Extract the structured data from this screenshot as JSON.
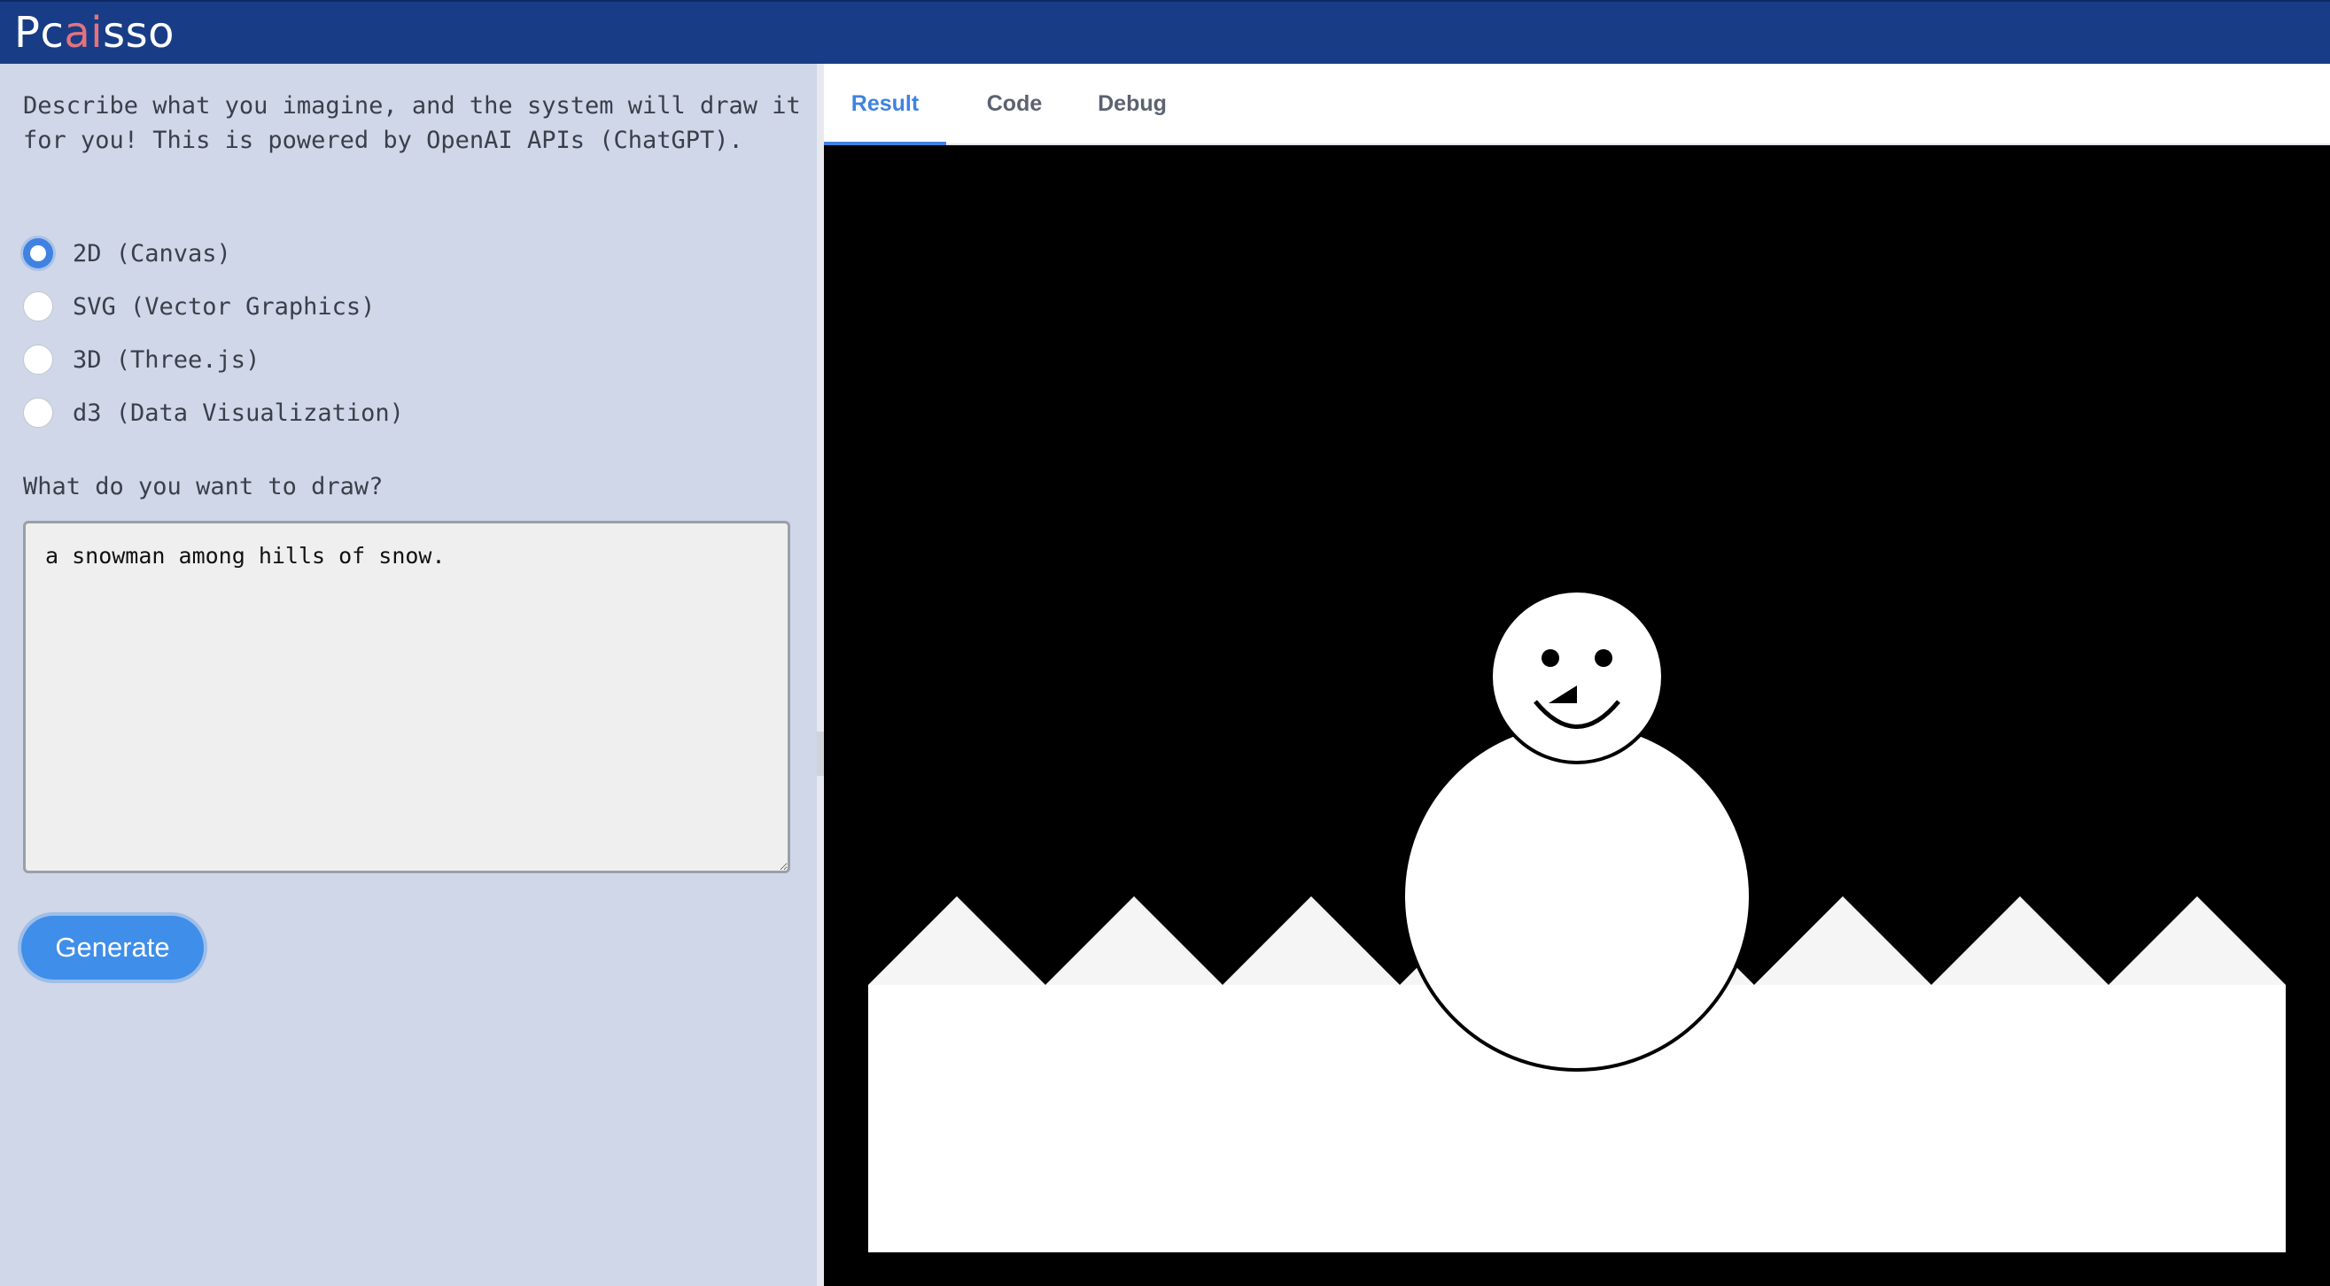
{
  "header": {
    "logo_prefix": "Pc",
    "logo_accent": "ai",
    "logo_suffix": "sso",
    "bar_color": "#183d86",
    "accent_color": "#e4737d"
  },
  "sidebar": {
    "intro": "Describe what you imagine, and the system will draw it for you! This is powered by OpenAI APIs (ChatGPT).",
    "modes": [
      {
        "label": "2D (Canvas)",
        "selected": true
      },
      {
        "label": "SVG (Vector Graphics)",
        "selected": false
      },
      {
        "label": "3D (Three.js)",
        "selected": false
      },
      {
        "label": "d3 (Data Visualization)",
        "selected": false
      }
    ],
    "prompt_label": "What do you want to draw?",
    "prompt_value": "a snowman among hills of snow.",
    "generate_label": "Generate",
    "button_color": "#3f8ee9"
  },
  "tabs": [
    {
      "label": "Result",
      "active": true
    },
    {
      "label": "Code",
      "active": false
    },
    {
      "label": "Debug",
      "active": false
    }
  ],
  "result": {
    "background_color": "#000000",
    "hill_color": "#f5f5f5",
    "ground_color": "#ffffff",
    "hill_count": 8,
    "snowman": {
      "body_color": "#ffffff",
      "outline_color": "#000000",
      "eyes": 2,
      "has_nose": true,
      "has_smile": true
    }
  }
}
